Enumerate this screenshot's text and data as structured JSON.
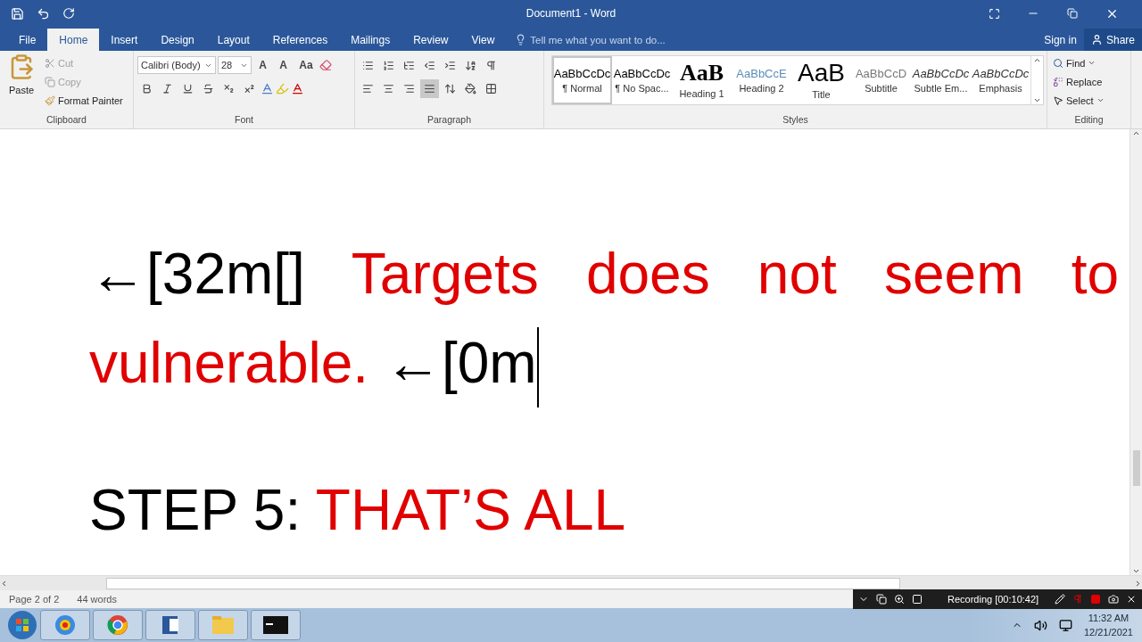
{
  "window": {
    "title": "Document1 - Word"
  },
  "tabs": [
    {
      "label": "File",
      "selected": false
    },
    {
      "label": "Home",
      "selected": true
    },
    {
      "label": "Insert",
      "selected": false
    },
    {
      "label": "Design",
      "selected": false
    },
    {
      "label": "Layout",
      "selected": false
    },
    {
      "label": "References",
      "selected": false
    },
    {
      "label": "Mailings",
      "selected": false
    },
    {
      "label": "Review",
      "selected": false
    },
    {
      "label": "View",
      "selected": false
    }
  ],
  "tell_me": {
    "placeholder": "Tell me what you want to do..."
  },
  "account": {
    "sign_in": "Sign in",
    "share": "Share"
  },
  "clipboard": {
    "paste": "Paste",
    "cut": {
      "label": "Cut",
      "disabled": true
    },
    "copy": {
      "label": "Copy",
      "disabled": true
    },
    "format_painter": "Format Painter",
    "label": "Clipboard"
  },
  "font": {
    "name": "Calibri (Body)",
    "size": "28",
    "grow": "A",
    "shrink": "A",
    "change_case": "Aa",
    "label": "Font"
  },
  "paragraph": {
    "label": "Paragraph"
  },
  "styles": {
    "label": "Styles",
    "items": [
      {
        "preview": "AaBbCcDc",
        "name": "¶ Normal",
        "kind": "normal",
        "selected": true
      },
      {
        "preview": "AaBbCcDc",
        "name": "¶ No Spac...",
        "kind": "normal",
        "selected": false
      },
      {
        "preview": "AaB",
        "name": "Heading 1",
        "kind": "heading1",
        "selected": false
      },
      {
        "preview": "AaBbCcE",
        "name": "Heading 2",
        "kind": "heading2",
        "selected": false
      },
      {
        "preview": "AaB",
        "name": "Title",
        "kind": "title",
        "selected": false
      },
      {
        "preview": "AaBbCcD",
        "name": "Subtitle",
        "kind": "subtitle",
        "selected": false
      },
      {
        "preview": "AaBbCcDc",
        "name": "Subtle Em...",
        "kind": "italic",
        "selected": false
      },
      {
        "preview": "AaBbCcDc",
        "name": "Emphasis",
        "kind": "italic",
        "selected": false
      }
    ]
  },
  "editing": {
    "find": "Find",
    "replace": "Replace",
    "select": "Select",
    "label": "Editing"
  },
  "document": {
    "lines": [
      {
        "justified": true,
        "segments": [
          {
            "text": "←[32m[]",
            "color": "#000000"
          },
          {
            "text": "Targets does not seem to",
            "color": "#e00000"
          }
        ]
      },
      {
        "justified": false,
        "cursor": true,
        "segments": [
          {
            "text": "vulnerable.",
            "color": "#e00000"
          },
          {
            "text": "←[0m",
            "color": "#000000"
          }
        ]
      },
      {
        "justified": false,
        "segments": [
          {
            "text": "STEP 5:",
            "color": "#000000"
          },
          {
            "text": "THAT’S ALL",
            "color": "#e00000"
          }
        ]
      }
    ]
  },
  "status_bar": {
    "page": "Page 2 of 2",
    "words": "44 words"
  },
  "recorder": {
    "status": "Recording [00:10:42]"
  },
  "taskbar": {
    "time": "11:32 AM",
    "date": "12/21/2021"
  }
}
